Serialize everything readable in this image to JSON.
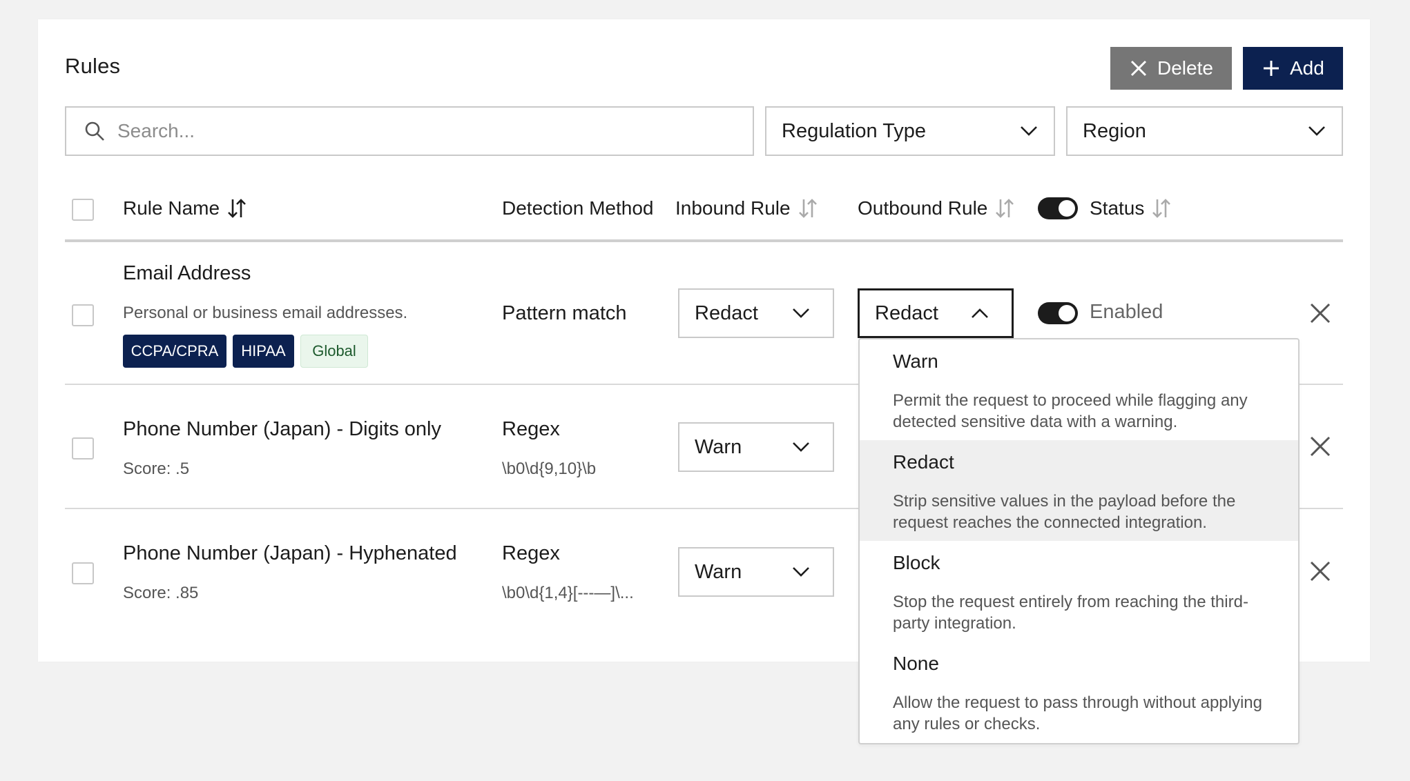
{
  "page": {
    "title": "Rules"
  },
  "toolbar": {
    "delete_label": "Delete",
    "add_label": "Add"
  },
  "filters": {
    "search_placeholder": "Search...",
    "regulation_type": "Regulation Type",
    "region": "Region"
  },
  "table": {
    "headers": {
      "rule_name": "Rule Name",
      "detection_method": "Detection Method",
      "inbound_rule": "Inbound Rule",
      "outbound_rule": "Outbound Rule",
      "status": "Status"
    },
    "status_header_toggle": "on",
    "rows": [
      {
        "name": "Email Address",
        "description": "Personal or business email addresses.",
        "tags": [
          "CCPA/CPRA",
          "HIPAA",
          "Global"
        ],
        "method": "Pattern match",
        "inbound": "Redact",
        "outbound": "Redact",
        "status": "Enabled"
      },
      {
        "name": "Phone Number (Japan) - Digits only",
        "score": "Score: .5",
        "method": "Regex",
        "pattern": "\\b0\\d{9,10}\\b",
        "inbound": "Warn"
      },
      {
        "name": "Phone Number (Japan) - Hyphenated",
        "score": "Score: .85",
        "method": "Regex",
        "pattern": "\\b0\\d{1,4}[---—]\\...",
        "inbound": "Warn"
      }
    ]
  },
  "outbound_menu": {
    "options": [
      {
        "title": "Warn",
        "description": "Permit the request to proceed while flagging any detected sensitive data with a warning."
      },
      {
        "title": "Redact",
        "description": "Strip sensitive values in the payload before the request reaches the connected integration."
      },
      {
        "title": "Block",
        "description": "Stop the request entirely from reaching the third-party integration."
      },
      {
        "title": "None",
        "description": "Allow the request to pass through without applying any rules or checks."
      }
    ],
    "highlighted": "Redact"
  },
  "colors": {
    "primary": "#0c2150",
    "delete_bg": "#767676",
    "tag_light_bg": "#eaf6ec"
  }
}
